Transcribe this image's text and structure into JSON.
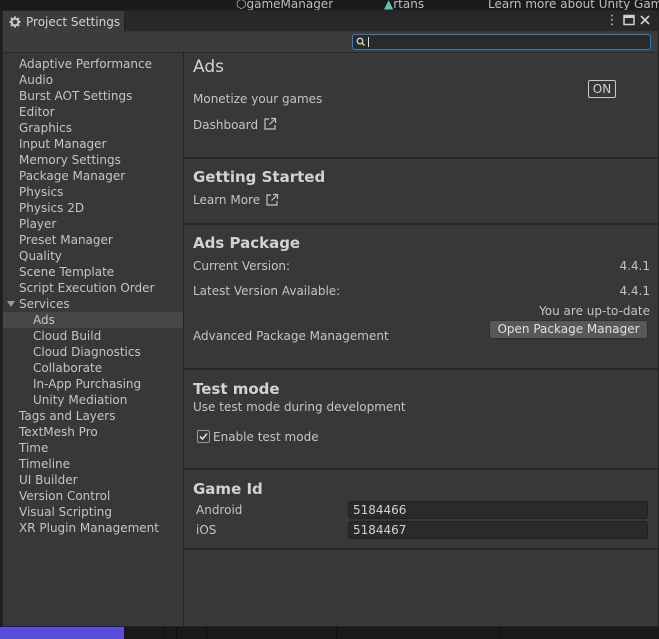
{
  "background_window": {
    "tab_game_manager": "gameManager",
    "tab_rtans": "rtans",
    "learn_more_text": "Learn more about Unity Gamin"
  },
  "window": {
    "title": "Project Settings",
    "title_icon": "gear-icon"
  },
  "search": {
    "value": "",
    "placeholder": ""
  },
  "sidebar": {
    "items": [
      {
        "label": "Adaptive Performance"
      },
      {
        "label": "Audio"
      },
      {
        "label": "Burst AOT Settings"
      },
      {
        "label": "Editor"
      },
      {
        "label": "Graphics"
      },
      {
        "label": "Input Manager"
      },
      {
        "label": "Memory Settings"
      },
      {
        "label": "Package Manager"
      },
      {
        "label": "Physics"
      },
      {
        "label": "Physics 2D"
      },
      {
        "label": "Player"
      },
      {
        "label": "Preset Manager"
      },
      {
        "label": "Quality"
      },
      {
        "label": "Scene Template"
      },
      {
        "label": "Script Execution Order"
      },
      {
        "label": "Services"
      },
      {
        "label": "Ads"
      },
      {
        "label": "Cloud Build"
      },
      {
        "label": "Cloud Diagnostics"
      },
      {
        "label": "Collaborate"
      },
      {
        "label": "In-App Purchasing"
      },
      {
        "label": "Unity Mediation"
      },
      {
        "label": "Tags and Layers"
      },
      {
        "label": "TextMesh Pro"
      },
      {
        "label": "Time"
      },
      {
        "label": "Timeline"
      },
      {
        "label": "UI Builder"
      },
      {
        "label": "Version Control"
      },
      {
        "label": "Visual Scripting"
      },
      {
        "label": "XR Plugin Management"
      }
    ],
    "selected": "Ads"
  },
  "content": {
    "title": "Ads",
    "toggle_label": "ON",
    "monetize_text": "Monetize your games",
    "dashboard_link": "Dashboard",
    "getting_started": {
      "heading": "Getting Started",
      "learn_more": "Learn More"
    },
    "ads_package": {
      "heading": "Ads Package",
      "current_version_label": "Current Version:",
      "current_version_value": "4.4.1",
      "latest_version_label": "Latest Version Available:",
      "latest_version_value": "4.4.1",
      "status": "You are up-to-date",
      "advanced_label": "Advanced Package Management",
      "open_button": "Open Package Manager"
    },
    "test_mode": {
      "heading": "Test mode",
      "description": "Use test mode during development",
      "checkbox_label": "Enable test mode",
      "checked": true
    },
    "game_id": {
      "heading": "Game Id",
      "android_label": "Android",
      "android_value": "5184466",
      "ios_label": "iOS",
      "ios_value": "5184467"
    }
  },
  "colors": {
    "window_bg": "#383838",
    "selected_row": "#474747",
    "search_focus": "#3a79bb",
    "button_bg": "#585858"
  }
}
